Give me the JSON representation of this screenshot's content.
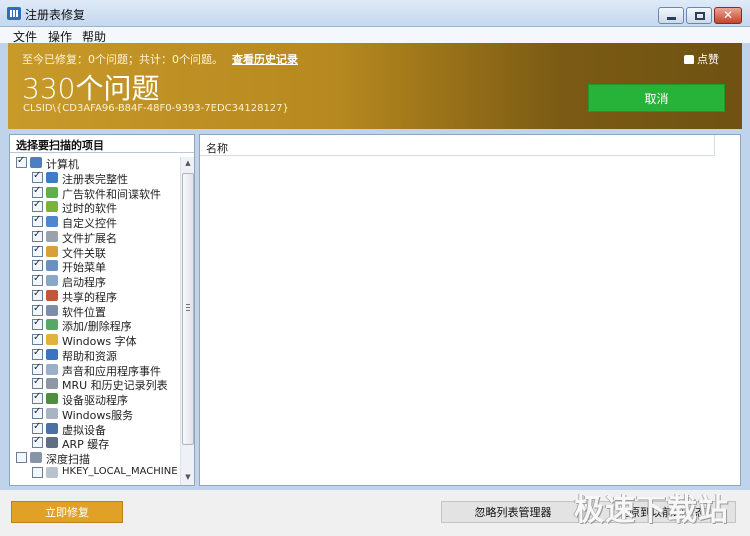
{
  "window": {
    "title": "注册表修复"
  },
  "menu": {
    "items": [
      "文件",
      "操作",
      "帮助"
    ]
  },
  "banner": {
    "stats": "至今已修复：0个问题；共计：0个问题。",
    "history_link": "查看历史记录",
    "like_label": "点赞",
    "issue_count": "330个问题",
    "clsid": "CLSID\\{CD3AFA96-B84F-48F0-9393-7EDC34128127}",
    "cancel_label": "取消"
  },
  "left_panel": {
    "header": "选择要扫描的项目",
    "tree": [
      {
        "label": "计算机",
        "level": 0,
        "checked": true,
        "icon": "computer-icon"
      },
      {
        "label": "注册表完整性",
        "level": 1,
        "checked": true,
        "icon": "registry-icon"
      },
      {
        "label": "广告软件和间谍软件",
        "level": 1,
        "checked": true,
        "icon": "adware-icon"
      },
      {
        "label": "过时的软件",
        "level": 1,
        "checked": true,
        "icon": "trash-icon"
      },
      {
        "label": "自定义控件",
        "level": 1,
        "checked": true,
        "icon": "controls-icon"
      },
      {
        "label": "文件扩展名",
        "level": 1,
        "checked": true,
        "icon": "file-ext-icon"
      },
      {
        "label": "文件关联",
        "level": 1,
        "checked": true,
        "icon": "file-assoc-icon"
      },
      {
        "label": "开始菜单",
        "level": 1,
        "checked": true,
        "icon": "start-menu-icon"
      },
      {
        "label": "启动程序",
        "level": 1,
        "checked": true,
        "icon": "startup-icon"
      },
      {
        "label": "共享的程序",
        "level": 1,
        "checked": true,
        "icon": "shared-icon"
      },
      {
        "label": "软件位置",
        "level": 1,
        "checked": true,
        "icon": "software-location-icon"
      },
      {
        "label": "添加/删除程序",
        "level": 1,
        "checked": true,
        "icon": "add-remove-icon"
      },
      {
        "label": "Windows 字体",
        "level": 1,
        "checked": true,
        "icon": "font-icon"
      },
      {
        "label": "帮助和资源",
        "level": 1,
        "checked": true,
        "icon": "help-icon"
      },
      {
        "label": "声音和应用程序事件",
        "level": 1,
        "checked": true,
        "icon": "sound-icon"
      },
      {
        "label": "MRU 和历史记录列表",
        "level": 1,
        "checked": true,
        "icon": "history-icon"
      },
      {
        "label": "设备驱动程序",
        "level": 1,
        "checked": true,
        "icon": "driver-icon"
      },
      {
        "label": "Windows服务",
        "level": 1,
        "checked": true,
        "icon": "services-icon"
      },
      {
        "label": "虚拟设备",
        "level": 1,
        "checked": true,
        "icon": "virtual-device-icon"
      },
      {
        "label": "ARP 缓存",
        "level": 1,
        "checked": true,
        "icon": "arp-icon"
      },
      {
        "label": "深度扫描",
        "level": 0,
        "checked": false,
        "icon": "deep-scan-icon"
      },
      {
        "label": "HKEY_LOCAL_MACHINE",
        "level": 1,
        "checked": false,
        "icon": "hive-icon"
      }
    ]
  },
  "right_panel": {
    "column_name": "名称"
  },
  "footer": {
    "fix_label": "立即修复",
    "ignore_label": "忽略列表管理器",
    "restore_label": "还原到以前的状态"
  },
  "watermark": "极速下载站",
  "colors": {
    "banner_gold": "#b6881f",
    "cancel_green": "#27b33a",
    "fix_orange": "#e0a126"
  }
}
